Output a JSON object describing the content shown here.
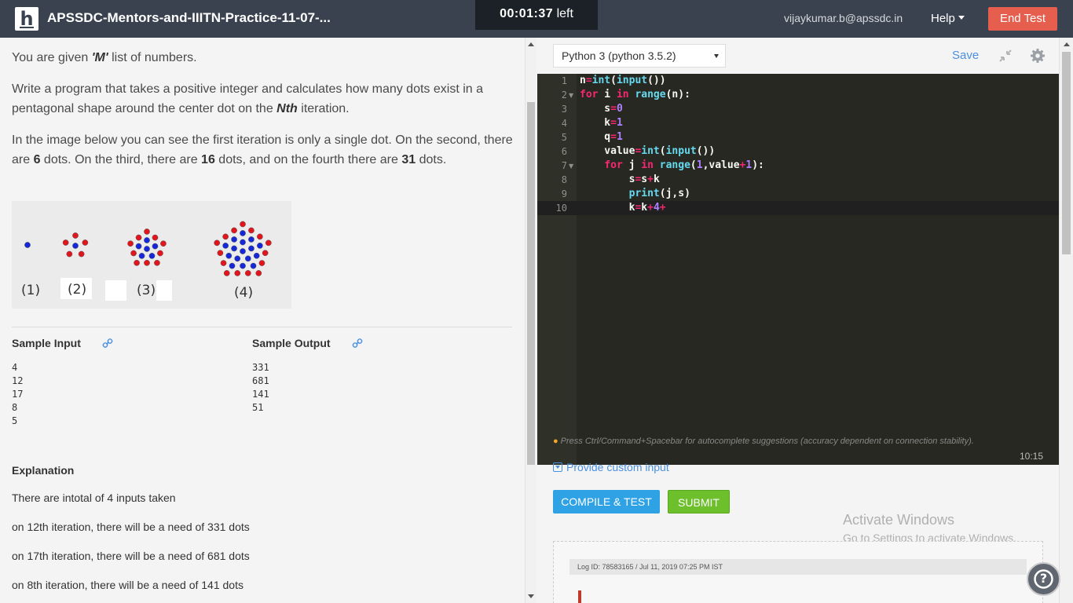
{
  "header": {
    "logo_letter": "h",
    "test_title": "APSSDC-Mentors-and-IIITN-Practice-11-07-...",
    "timer_value": "00:01:37",
    "timer_suffix": "left",
    "user_email": "vijaykumar.b@apssdc.in",
    "help_label": "Help",
    "end_test_label": "End Test"
  },
  "problem": {
    "intro_pre": "You are given ",
    "intro_var": "'M'",
    "intro_post": " list of numbers.",
    "para2_pre": "Write a program that takes a positive integer and calculates how many dots exist in a pentagonal shape around the center dot on the ",
    "para2_var": "Nth",
    "para2_post": " iteration.",
    "para3_a": "In the image below you can see the first iteration is only a single dot. On the second, there are ",
    "para3_n1": "6",
    "para3_b": " dots. On the third, there are ",
    "para3_n2": "16",
    "para3_c": " dots, and on the fourth there are ",
    "para3_n3": "31",
    "para3_d": " dots.",
    "figure_labels": [
      "(1)",
      "(2)",
      "(3)",
      "(4)"
    ],
    "dot_colors": {
      "outer": "#e2141c",
      "inner": "#1627d9"
    }
  },
  "samples": {
    "input_heading": "Sample Input",
    "output_heading": "Sample Output",
    "input_lines": [
      "4",
      "12",
      "17",
      "8",
      "5"
    ],
    "output_lines": [
      "331",
      "681",
      "141",
      "51"
    ]
  },
  "explanation": {
    "heading": "Explanation",
    "lines": [
      "There are intotal of 4 inputs taken",
      "on 12th iteration, there will be a need of 331 dots",
      "on 17th iteration, there will be a need of 681 dots",
      "on 8th iteration, there will be a need of 141 dots"
    ]
  },
  "editor": {
    "language": "Python 3 (python 3.5.2)",
    "save_label": "Save",
    "line_numbers": [
      "1",
      "2",
      "3",
      "4",
      "5",
      "6",
      "7",
      "8",
      "9",
      "10"
    ],
    "code_lines": [
      "n=int(input())",
      "for i in range(n):",
      "    s=0",
      "    k=1",
      "    q=1",
      "    value=int(input())",
      "    for j in range(1,value+1):",
      "        s=s+k",
      "        print(j,s)",
      "        k=k+4+"
    ],
    "cursor_position": "10:15",
    "hint": "Press Ctrl/Command+Spacebar for autocomplete suggestions (accuracy dependent on connection stability).",
    "custom_input_label": "Provide custom input",
    "compile_label": "COMPILE & TEST",
    "submit_label": "SUBMIT"
  },
  "log": {
    "text": "Log ID: 78583165 / Jul 11, 2019 07:25 PM IST"
  },
  "watermark": {
    "line1": "Activate Windows",
    "line2": "Go to Settings to activate Windows."
  },
  "help_bubble_symbol": "?"
}
